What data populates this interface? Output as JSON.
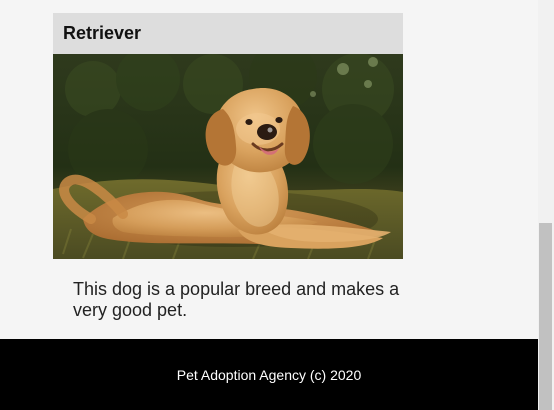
{
  "card": {
    "title": "Retriever",
    "image": {
      "alt": "Golden retriever lying in grass"
    },
    "description": "This dog is a popular breed and makes a very good pet."
  },
  "footer": {
    "text": "Pet Adoption Agency (c) 2020"
  }
}
